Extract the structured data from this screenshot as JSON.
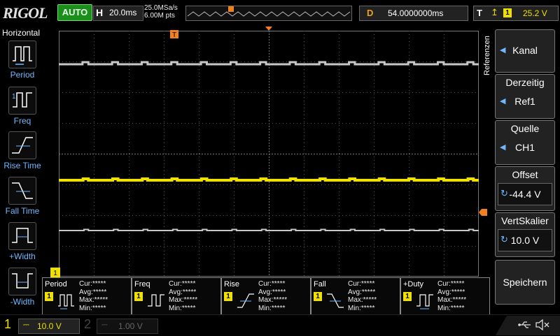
{
  "top": {
    "logo": "RIGOL",
    "run_mode": "AUTO",
    "timebase_label": "H",
    "timebase_value": "20.0ms",
    "sample_rate": "25.0MSa/s",
    "mem_depth": "6.00M pts",
    "delay_label": "D",
    "delay_value": "54.0000000ms",
    "trigger_label": "T",
    "trigger_channel": "1",
    "trigger_level": "25.2 V",
    "trigger_marker": "T"
  },
  "left_menu": {
    "title": "Horizontal",
    "items": [
      {
        "label": "Period"
      },
      {
        "label": "Freq"
      },
      {
        "label": "Rise Time"
      },
      {
        "label": "Fall Time"
      },
      {
        "label": "+Width"
      },
      {
        "label": "-Width"
      }
    ]
  },
  "right_menu": {
    "side_label": "Referenzen",
    "items": [
      {
        "title": "",
        "value": "Kanal",
        "marker": "arrow"
      },
      {
        "title": "Derzeitig",
        "value": "Ref1",
        "marker": "arrow"
      },
      {
        "title": "Quelle",
        "value": "CH1",
        "marker": "arrow"
      },
      {
        "title": "Offset",
        "value": "-44.4 V",
        "marker": "knob"
      },
      {
        "title": "VertSkalier",
        "value": "10.0 V",
        "marker": "knob"
      },
      {
        "title": "",
        "value": "Speichern",
        "marker": "none"
      }
    ]
  },
  "measurements": [
    {
      "name": "Period",
      "channel": "1",
      "cur": "Cur:*****",
      "avg": "Avg:*****",
      "max": "Max:*****",
      "min": "Min:*****"
    },
    {
      "name": "Freq",
      "channel": "1",
      "cur": "Cur:*****",
      "avg": "Avg:*****",
      "max": "Max:*****",
      "min": "Min:*****"
    },
    {
      "name": "Rise",
      "channel": "1",
      "cur": "Cur:*****",
      "avg": "Avg:*****",
      "max": "Max:*****",
      "min": "Min:*****"
    },
    {
      "name": "Fall",
      "channel": "1",
      "cur": "Cur:*****",
      "avg": "Avg:*****",
      "max": "Max:*****",
      "min": "Min:*****"
    },
    {
      "name": "+Duty",
      "channel": "1",
      "cur": "Cur:*****",
      "avg": "Avg:*****",
      "max": "Max:*****",
      "min": "Min:*****"
    }
  ],
  "bottom": {
    "ch1_num": "1",
    "ch1_scale": "10.0 V",
    "ch2_num": "2",
    "ch2_scale": "1.00 V"
  },
  "colors": {
    "ch1": "#f0e000",
    "ref": "#c8c8c8",
    "accent": "#6fb8ff",
    "trigger": "#f08020"
  },
  "icons": {
    "usb": "usb-icon",
    "speaker": "speaker-muted-icon"
  }
}
